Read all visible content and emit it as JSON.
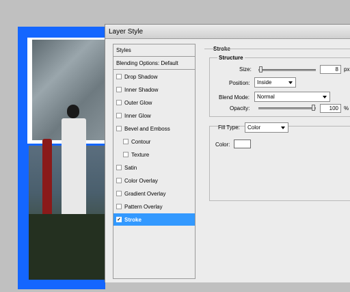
{
  "dialog": {
    "title": "Layer Style"
  },
  "styles_list": {
    "header": "Styles",
    "blending_options": "Blending Options: Default",
    "items": [
      {
        "label": "Drop Shadow",
        "checked": false,
        "indent": false
      },
      {
        "label": "Inner Shadow",
        "checked": false,
        "indent": false
      },
      {
        "label": "Outer Glow",
        "checked": false,
        "indent": false
      },
      {
        "label": "Inner Glow",
        "checked": false,
        "indent": false
      },
      {
        "label": "Bevel and Emboss",
        "checked": false,
        "indent": false
      },
      {
        "label": "Contour",
        "checked": false,
        "indent": true
      },
      {
        "label": "Texture",
        "checked": false,
        "indent": true
      },
      {
        "label": "Satin",
        "checked": false,
        "indent": false
      },
      {
        "label": "Color Overlay",
        "checked": false,
        "indent": false
      },
      {
        "label": "Gradient Overlay",
        "checked": false,
        "indent": false
      },
      {
        "label": "Pattern Overlay",
        "checked": false,
        "indent": false
      },
      {
        "label": "Stroke",
        "checked": true,
        "indent": false,
        "selected": true
      }
    ]
  },
  "stroke": {
    "section_title": "Stroke",
    "structure_title": "Structure",
    "size_label": "Size:",
    "size_value": "8",
    "size_unit": "px",
    "position_label": "Position:",
    "position_value": "Inside",
    "blend_mode_label": "Blend Mode:",
    "blend_mode_value": "Normal",
    "opacity_label": "Opacity:",
    "opacity_value": "100",
    "opacity_unit": "%",
    "fill_type_label": "Fill Type:",
    "fill_type_value": "Color",
    "color_label": "Color:",
    "color_value": "#ffffff"
  },
  "colors": {
    "canvas_blue": "#1466ff",
    "selection": "#3399ff"
  }
}
